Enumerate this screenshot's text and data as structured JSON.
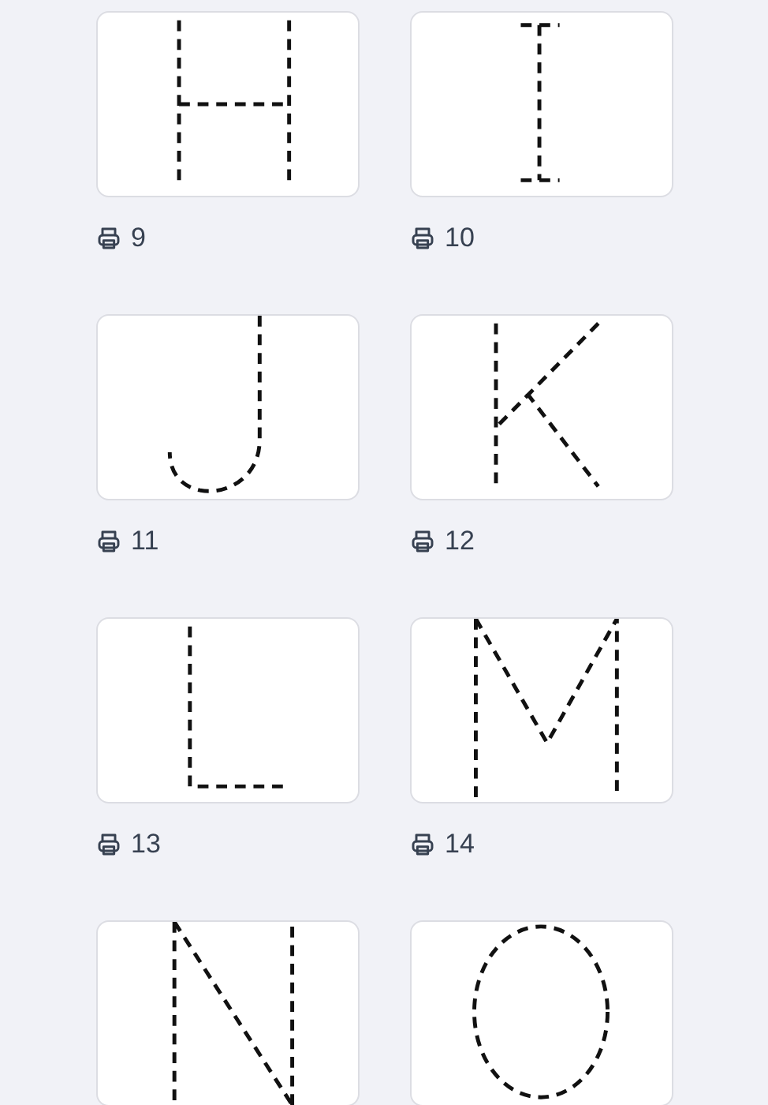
{
  "worksheets": [
    {
      "kind": "letter_h",
      "number": "9"
    },
    {
      "kind": "letter_i",
      "number": "10"
    },
    {
      "kind": "letter_j",
      "number": "11"
    },
    {
      "kind": "letter_k",
      "number": "12"
    },
    {
      "kind": "letter_l",
      "number": "13"
    },
    {
      "kind": "letter_m",
      "number": "14"
    },
    {
      "kind": "letter_n"
    },
    {
      "kind": "letter_o"
    }
  ]
}
